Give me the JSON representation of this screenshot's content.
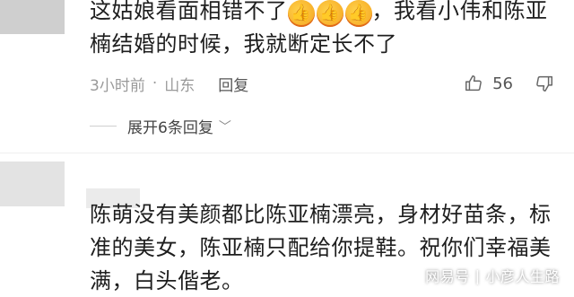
{
  "comment1": {
    "text_before": "这姑娘看面相错不了",
    "emoji": [
      "thumbs-up-icon",
      "thumbs-up-icon",
      "thumbs-up-icon"
    ],
    "text_after": "，我看小伟和陈亚楠结婚的时候，我就断定长不了",
    "time": "3小时前",
    "separator": "·",
    "location": "山东",
    "reply_label": "回复",
    "like_count": "56"
  },
  "expand": {
    "label": "展开6条回复",
    "chevron": "﹀"
  },
  "comment2": {
    "text": "陈萌没有美颜都比陈亚楠漂亮，身材好苗条，标准的美女，陈亚楠只配给你提鞋。祝你们幸福美满，白头偕老。"
  },
  "watermark": {
    "source": "网易号",
    "separator": "|",
    "author": "小彦人生路"
  }
}
